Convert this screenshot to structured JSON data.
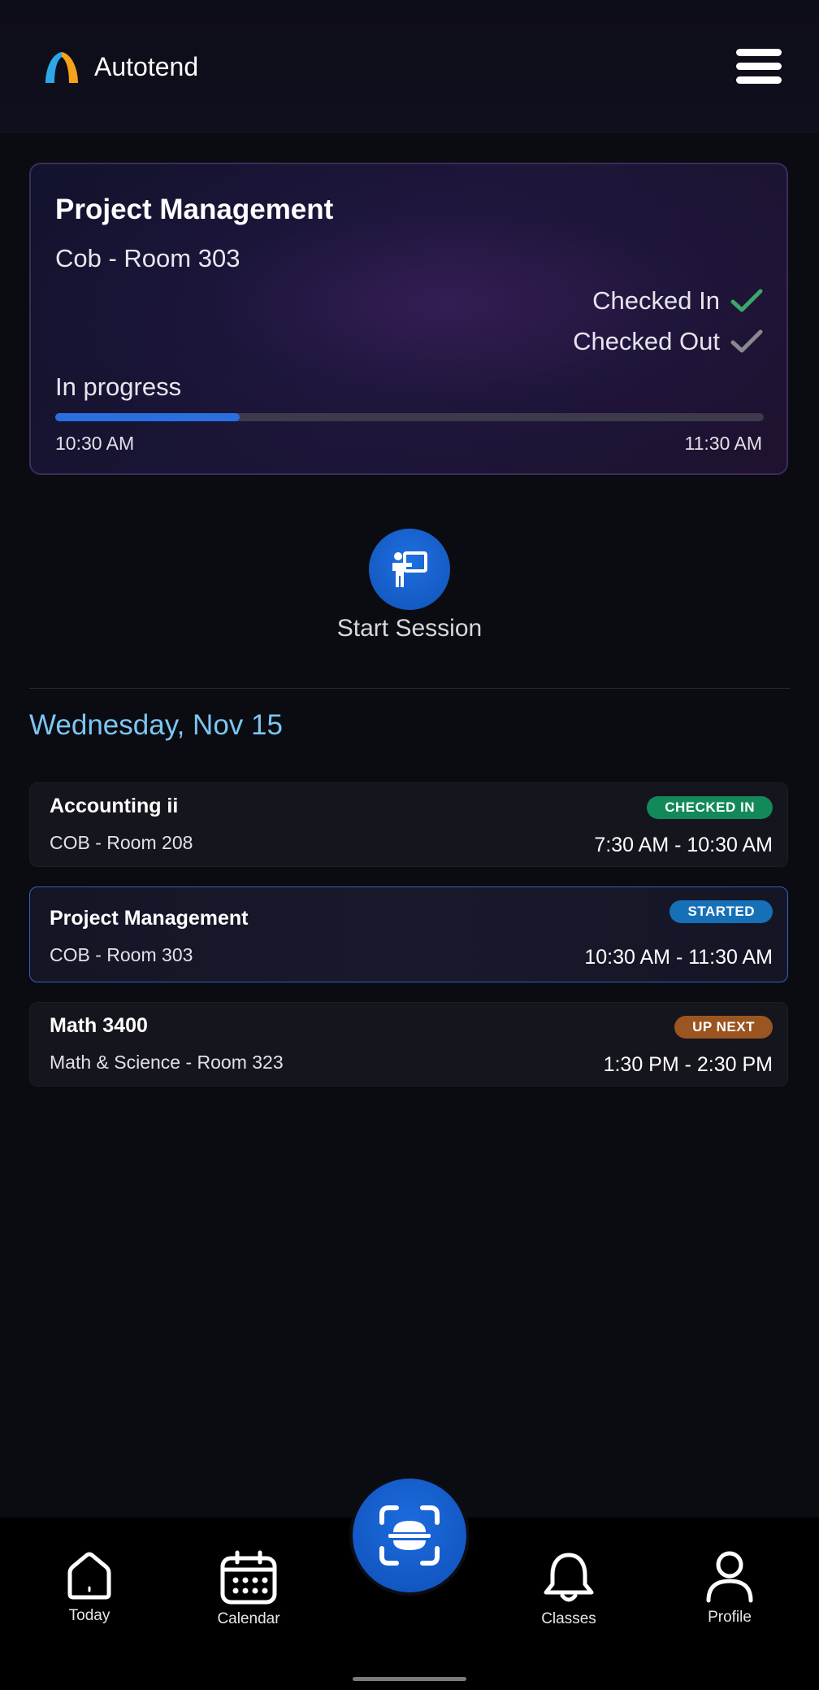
{
  "header": {
    "app_name": "Autotend"
  },
  "current_session": {
    "title": "Project Management",
    "room": "Cob - Room 303",
    "checked_in_label": "Checked In",
    "checked_out_label": "Checked Out",
    "status": "In progress",
    "progress_fraction": 0.26,
    "start_time": "10:30 AM",
    "end_time": "11:30 AM",
    "checked_in_color": "#3aa86a",
    "checked_out_color": "#8a8992"
  },
  "start_session": {
    "label": "Start Session"
  },
  "schedule": {
    "date": "Wednesday, Nov 15",
    "classes": [
      {
        "name": "Accounting ii",
        "room": "COB - Room 208",
        "time": "7:30 AM - 10:30 AM",
        "badge": "CHECKED IN",
        "badge_color": "#13895a"
      },
      {
        "name": "Project Management",
        "room": "COB - Room 303",
        "time": "10:30 AM - 11:30 AM",
        "badge": "STARTED",
        "badge_color": "#1670b8"
      },
      {
        "name": "Math 3400",
        "room": "Math & Science - Room 323",
        "time": "1:30 PM - 2:30 PM",
        "badge": "UP NEXT",
        "badge_color": "#9a5520"
      }
    ]
  },
  "bottom_nav": {
    "items": [
      {
        "label": "Today",
        "icon": "home-icon"
      },
      {
        "label": "Calendar",
        "icon": "calendar-icon"
      },
      {
        "label": "Classes",
        "icon": "bell-icon"
      },
      {
        "label": "Profile",
        "icon": "profile-icon"
      }
    ],
    "center_icon": "scan-icon"
  }
}
